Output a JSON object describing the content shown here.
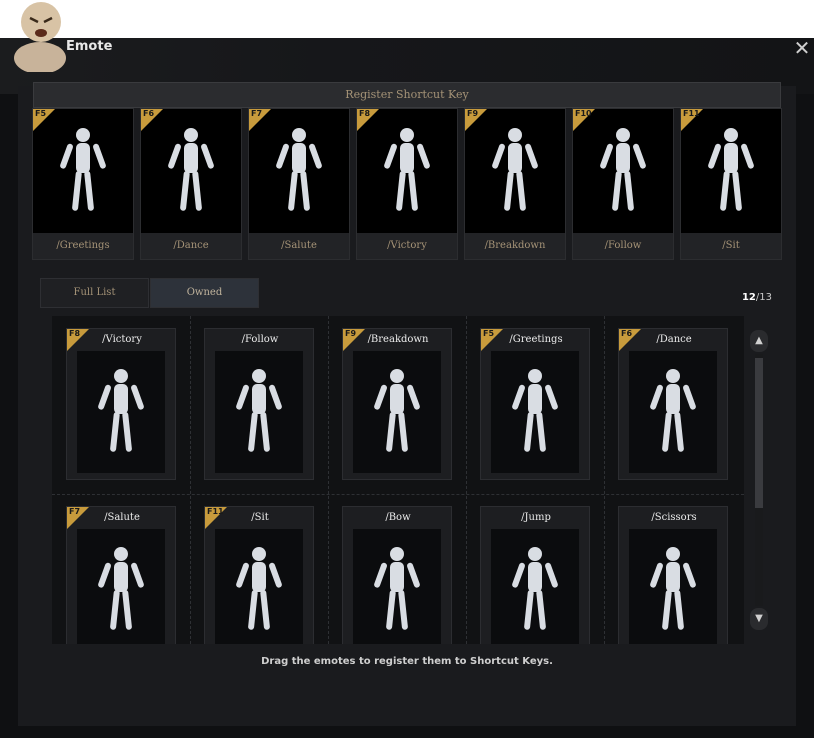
{
  "window": {
    "title": "Emote",
    "close_symbol": "✕"
  },
  "shortcut": {
    "header": "Register Shortcut Key",
    "slots": [
      {
        "key": "F5",
        "label": "/Greetings"
      },
      {
        "key": "F6",
        "label": "/Dance"
      },
      {
        "key": "F7",
        "label": "/Salute"
      },
      {
        "key": "F8",
        "label": "/Victory"
      },
      {
        "key": "F9",
        "label": "/Breakdown"
      },
      {
        "key": "F10",
        "label": "/Follow"
      },
      {
        "key": "F11",
        "label": "/Sit"
      }
    ]
  },
  "tabs": {
    "full_list": "Full List",
    "owned": "Owned"
  },
  "counter": {
    "owned": "12",
    "separator": "/",
    "total": "13"
  },
  "emotes": [
    {
      "key": "F8",
      "name": "/Victory"
    },
    {
      "key": "",
      "name": "/Follow"
    },
    {
      "key": "F9",
      "name": "/Breakdown"
    },
    {
      "key": "F5",
      "name": "/Greetings"
    },
    {
      "key": "F6",
      "name": "/Dance"
    },
    {
      "key": "F7",
      "name": "/Salute"
    },
    {
      "key": "F11",
      "name": "/Sit"
    },
    {
      "key": "",
      "name": "/Bow"
    },
    {
      "key": "",
      "name": "/Jump"
    },
    {
      "key": "",
      "name": "/Scissors"
    }
  ],
  "scrollbar": {
    "up": "▲",
    "down": "▼"
  },
  "hint": "Drag the emotes to register them to Shortcut Keys.",
  "colors": {
    "accent_gold": "#c89b3c",
    "label_tan": "#a59377",
    "background": "#0f1012"
  }
}
